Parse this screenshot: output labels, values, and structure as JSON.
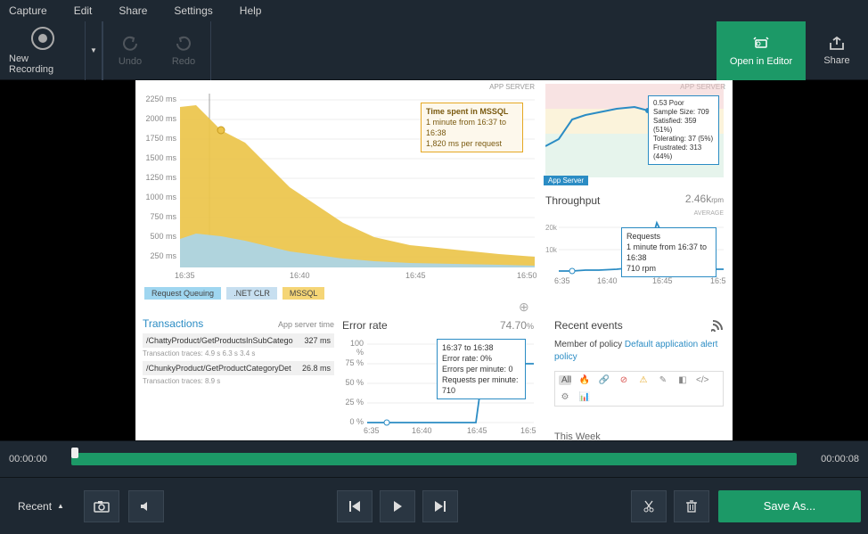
{
  "menubar": {
    "items": [
      "Capture",
      "Edit",
      "Share",
      "Settings",
      "Help"
    ]
  },
  "toolbar": {
    "new_recording": "New Recording",
    "undo": "Undo",
    "redo": "Redo",
    "open_editor": "Open in Editor",
    "share": "Share"
  },
  "timeline": {
    "start": "00:00:00",
    "end": "00:00:08"
  },
  "controls": {
    "recent": "Recent",
    "save_as": "Save As..."
  },
  "content": {
    "server_label_left": "APP SERVER",
    "server_label_right": "APP SERVER",
    "main_y_labels": [
      "2250 ms",
      "2000 ms",
      "1750 ms",
      "1500 ms",
      "1250 ms",
      "1000 ms",
      "750 ms",
      "500 ms",
      "250 ms"
    ],
    "main_x_labels": [
      "16:35",
      "16:40",
      "16:45",
      "16:50"
    ],
    "legend": {
      "rq": "Request Queuing",
      "net": ".NET CLR",
      "mssql": "MSSQL"
    },
    "tooltip_main": {
      "title": "Time spent in MSSQL",
      "line1": "1 minute from 16:37 to 16:38",
      "line2": "1,820 ms per request"
    },
    "tooltip_apdex": {
      "line1": "0.53 Poor",
      "line2": "Sample Size: 709",
      "line3": "Satisfied: 359 (51%)",
      "line4": "Tolerating: 37 (5%)",
      "line5": "Frustrated: 313 (44%)"
    },
    "app_server_tag": "App Server",
    "throughput": {
      "title": "Throughput",
      "value": "2.46k",
      "unit": "rpm",
      "sub": "AVERAGE",
      "y_labels": [
        "20k",
        "10k"
      ],
      "x_labels": [
        "6:35",
        "16:40",
        "16:45",
        "16:5"
      ]
    },
    "tooltip_throughput": {
      "line1": "Requests",
      "line2": "1 minute from 16:37 to 16:38",
      "line3": "710 rpm"
    },
    "transactions": {
      "title": "Transactions",
      "subtitle": "App server time",
      "rows": [
        {
          "name": "/ChattyProduct/GetProductsInSubCatego",
          "time": "327 ms",
          "trace": "Transaction traces:  4.9 s   6.3 s   3.4 s"
        },
        {
          "name": "/ChunkyProduct/GetProductCategoryDet",
          "time": "26.8 ms",
          "trace": "Transaction traces:  8.9 s"
        }
      ]
    },
    "errorrate": {
      "title": "Error rate",
      "value": "74.70",
      "unit": "%",
      "y_labels": [
        "100 %",
        "75 %",
        "50 %",
        "25 %",
        "0 %"
      ],
      "x_labels": [
        "6:35",
        "16:40",
        "16:45",
        "16:5"
      ]
    },
    "tooltip_error": {
      "line1": "16:37 to 16:38",
      "line2": "Error rate: 0%",
      "line3": "Errors per minute: 0",
      "line4": "Requests per minute: 710"
    },
    "events": {
      "title": "Recent events",
      "body_prefix": "Member of policy ",
      "body_link": "Default application alert policy",
      "icons": [
        "All",
        "🔥",
        "🔗",
        "⊘",
        "⚠",
        "✎",
        "◧",
        "</>",
        "⚙",
        "📊"
      ],
      "week": "This Week"
    }
  },
  "chart_data": [
    {
      "type": "area",
      "name": "time_spent",
      "x_minutes": [
        35,
        36,
        37,
        38,
        39,
        40,
        41,
        42,
        43,
        44,
        45,
        46,
        47,
        48,
        49,
        50
      ],
      "series": [
        {
          "name": "MSSQL",
          "values_ms": [
            1900,
            1950,
            1820,
            1700,
            1400,
            1100,
            850,
            600,
            400,
            350,
            320,
            300,
            280,
            260,
            250,
            240
          ]
        },
        {
          "name": ".NET CLR",
          "values_ms": [
            200,
            260,
            240,
            200,
            160,
            120,
            90,
            70,
            60,
            55,
            50,
            48,
            45,
            42,
            40,
            38
          ]
        },
        {
          "name": "Request Queuing",
          "values_ms": [
            20,
            25,
            24,
            22,
            18,
            15,
            12,
            10,
            9,
            8,
            8,
            7,
            7,
            6,
            6,
            6
          ]
        }
      ],
      "ylim_ms": [
        0,
        2250
      ],
      "xrange": [
        "16:35",
        "16:50"
      ]
    },
    {
      "type": "line",
      "name": "apdex",
      "x_minutes": [
        35,
        36,
        37,
        38,
        39,
        40
      ],
      "values": [
        0.62,
        0.58,
        0.53,
        0.51,
        0.55,
        0.54
      ],
      "bands": {
        "good": 0.9,
        "fair": 0.7,
        "poor": 0.5
      }
    },
    {
      "type": "line",
      "name": "throughput",
      "x_minutes": [
        35,
        36,
        37,
        38,
        39,
        40,
        41,
        42,
        43,
        44,
        45,
        46,
        47,
        48,
        49,
        50
      ],
      "values_rpm": [
        700,
        705,
        710,
        712,
        715,
        720,
        730,
        740,
        900,
        2500,
        18000,
        6000,
        1200,
        900,
        850,
        800
      ],
      "ylim_rpm": [
        0,
        20000
      ]
    },
    {
      "type": "line",
      "name": "error_rate",
      "x_minutes": [
        35,
        36,
        37,
        38,
        39,
        40,
        41,
        42,
        43,
        44,
        45,
        46,
        47,
        48,
        49,
        50
      ],
      "values_pct": [
        0,
        0,
        0,
        0,
        0,
        0,
        0,
        0,
        0,
        0,
        0,
        60,
        75,
        74,
        74,
        74.7
      ],
      "ylim_pct": [
        0,
        100
      ]
    }
  ]
}
